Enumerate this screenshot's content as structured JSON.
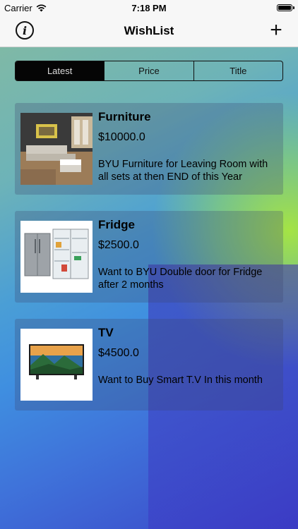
{
  "status": {
    "carrier": "Carrier",
    "time": "7:18 PM"
  },
  "nav": {
    "title": "WishList",
    "info_icon": "info-icon",
    "add_icon": "plus-icon"
  },
  "segments": [
    "Latest",
    "Price",
    "Title"
  ],
  "items": [
    {
      "name": "Furniture",
      "price": "$10000.0",
      "desc": "BYU Furniture for Leaving Room with all sets at then END of this Year",
      "image": "living-room-photo"
    },
    {
      "name": "Fridge",
      "price": "$2500.0",
      "desc": "Want to BYU Double door for Fridge after 2 months",
      "image": "fridge-photo"
    },
    {
      "name": "TV",
      "price": "$4500.0",
      "desc": "Want to Buy Smart T.V In this month",
      "image": "tv-photo"
    }
  ]
}
